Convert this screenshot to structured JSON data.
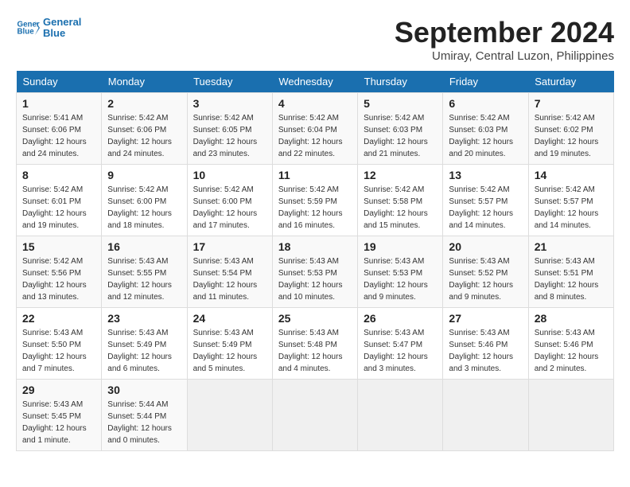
{
  "header": {
    "logo_line1": "General",
    "logo_line2": "Blue",
    "month_title": "September 2024",
    "subtitle": "Umiray, Central Luzon, Philippines"
  },
  "calendar": {
    "weekdays": [
      "Sunday",
      "Monday",
      "Tuesday",
      "Wednesday",
      "Thursday",
      "Friday",
      "Saturday"
    ],
    "weeks": [
      [
        {
          "day": "",
          "info": ""
        },
        {
          "day": "2",
          "info": "Sunrise: 5:42 AM\nSunset: 6:06 PM\nDaylight: 12 hours\nand 24 minutes."
        },
        {
          "day": "3",
          "info": "Sunrise: 5:42 AM\nSunset: 6:05 PM\nDaylight: 12 hours\nand 23 minutes."
        },
        {
          "day": "4",
          "info": "Sunrise: 5:42 AM\nSunset: 6:04 PM\nDaylight: 12 hours\nand 22 minutes."
        },
        {
          "day": "5",
          "info": "Sunrise: 5:42 AM\nSunset: 6:03 PM\nDaylight: 12 hours\nand 21 minutes."
        },
        {
          "day": "6",
          "info": "Sunrise: 5:42 AM\nSunset: 6:03 PM\nDaylight: 12 hours\nand 20 minutes."
        },
        {
          "day": "7",
          "info": "Sunrise: 5:42 AM\nSunset: 6:02 PM\nDaylight: 12 hours\nand 19 minutes."
        }
      ],
      [
        {
          "day": "1",
          "info": "Sunrise: 5:41 AM\nSunset: 6:06 PM\nDaylight: 12 hours\nand 24 minutes."
        },
        {
          "day": "9",
          "info": "Sunrise: 5:42 AM\nSunset: 6:00 PM\nDaylight: 12 hours\nand 18 minutes."
        },
        {
          "day": "10",
          "info": "Sunrise: 5:42 AM\nSunset: 6:00 PM\nDaylight: 12 hours\nand 17 minutes."
        },
        {
          "day": "11",
          "info": "Sunrise: 5:42 AM\nSunset: 5:59 PM\nDaylight: 12 hours\nand 16 minutes."
        },
        {
          "day": "12",
          "info": "Sunrise: 5:42 AM\nSunset: 5:58 PM\nDaylight: 12 hours\nand 15 minutes."
        },
        {
          "day": "13",
          "info": "Sunrise: 5:42 AM\nSunset: 5:57 PM\nDaylight: 12 hours\nand 14 minutes."
        },
        {
          "day": "14",
          "info": "Sunrise: 5:42 AM\nSunset: 5:57 PM\nDaylight: 12 hours\nand 14 minutes."
        }
      ],
      [
        {
          "day": "8",
          "info": "Sunrise: 5:42 AM\nSunset: 6:01 PM\nDaylight: 12 hours\nand 19 minutes."
        },
        {
          "day": "16",
          "info": "Sunrise: 5:43 AM\nSunset: 5:55 PM\nDaylight: 12 hours\nand 12 minutes."
        },
        {
          "day": "17",
          "info": "Sunrise: 5:43 AM\nSunset: 5:54 PM\nDaylight: 12 hours\nand 11 minutes."
        },
        {
          "day": "18",
          "info": "Sunrise: 5:43 AM\nSunset: 5:53 PM\nDaylight: 12 hours\nand 10 minutes."
        },
        {
          "day": "19",
          "info": "Sunrise: 5:43 AM\nSunset: 5:53 PM\nDaylight: 12 hours\nand 9 minutes."
        },
        {
          "day": "20",
          "info": "Sunrise: 5:43 AM\nSunset: 5:52 PM\nDaylight: 12 hours\nand 9 minutes."
        },
        {
          "day": "21",
          "info": "Sunrise: 5:43 AM\nSunset: 5:51 PM\nDaylight: 12 hours\nand 8 minutes."
        }
      ],
      [
        {
          "day": "15",
          "info": "Sunrise: 5:42 AM\nSunset: 5:56 PM\nDaylight: 12 hours\nand 13 minutes."
        },
        {
          "day": "23",
          "info": "Sunrise: 5:43 AM\nSunset: 5:49 PM\nDaylight: 12 hours\nand 6 minutes."
        },
        {
          "day": "24",
          "info": "Sunrise: 5:43 AM\nSunset: 5:49 PM\nDaylight: 12 hours\nand 5 minutes."
        },
        {
          "day": "25",
          "info": "Sunrise: 5:43 AM\nSunset: 5:48 PM\nDaylight: 12 hours\nand 4 minutes."
        },
        {
          "day": "26",
          "info": "Sunrise: 5:43 AM\nSunset: 5:47 PM\nDaylight: 12 hours\nand 3 minutes."
        },
        {
          "day": "27",
          "info": "Sunrise: 5:43 AM\nSunset: 5:46 PM\nDaylight: 12 hours\nand 3 minutes."
        },
        {
          "day": "28",
          "info": "Sunrise: 5:43 AM\nSunset: 5:46 PM\nDaylight: 12 hours\nand 2 minutes."
        }
      ],
      [
        {
          "day": "22",
          "info": "Sunrise: 5:43 AM\nSunset: 5:50 PM\nDaylight: 12 hours\nand 7 minutes."
        },
        {
          "day": "30",
          "info": "Sunrise: 5:44 AM\nSunset: 5:44 PM\nDaylight: 12 hours\nand 0 minutes."
        },
        {
          "day": "",
          "info": ""
        },
        {
          "day": "",
          "info": ""
        },
        {
          "day": "",
          "info": ""
        },
        {
          "day": "",
          "info": ""
        },
        {
          "day": "",
          "info": ""
        }
      ],
      [
        {
          "day": "29",
          "info": "Sunrise: 5:43 AM\nSunset: 5:45 PM\nDaylight: 12 hours\nand 1 minute."
        },
        {
          "day": "",
          "info": ""
        },
        {
          "day": "",
          "info": ""
        },
        {
          "day": "",
          "info": ""
        },
        {
          "day": "",
          "info": ""
        },
        {
          "day": "",
          "info": ""
        },
        {
          "day": "",
          "info": ""
        }
      ]
    ]
  }
}
